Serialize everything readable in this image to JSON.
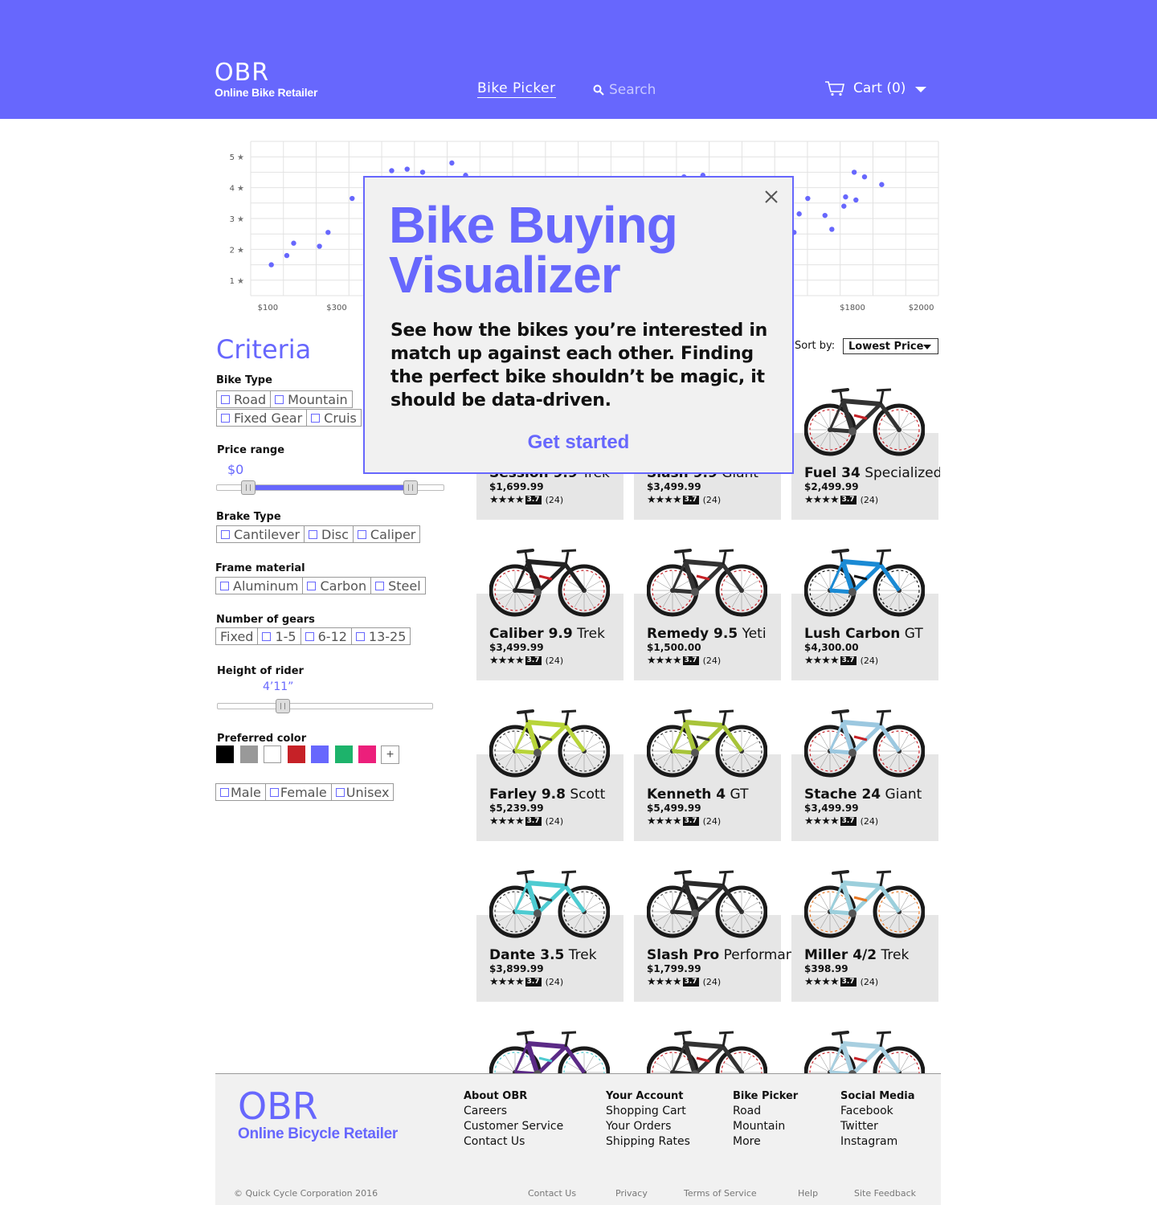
{
  "header": {
    "logo_mark": "OBR",
    "logo_sub": "Online Bike Retailer",
    "nav_link": "Bike Picker",
    "search_placeholder": "Search",
    "cart_label": "Cart (0)",
    "bg_color": "#6767fd"
  },
  "chart_data": {
    "type": "scatter",
    "xlabel": "",
    "ylabel": "",
    "x_ticks": [
      "$100",
      "$300",
      "$1800",
      "$2000"
    ],
    "x_tick_values": [
      100,
      300,
      1800,
      2000
    ],
    "y_ticks": [
      "1",
      "2",
      "3",
      "4",
      "5"
    ],
    "y_tick_values": [
      1,
      2,
      3,
      4,
      5
    ],
    "xlim": [
      50,
      2050
    ],
    "ylim": [
      0.5,
      5.5
    ],
    "grid": true,
    "point_color": "#6767fd",
    "points": [
      [
        110,
        1.5
      ],
      [
        155,
        1.8
      ],
      [
        175,
        2.2
      ],
      [
        250,
        2.1
      ],
      [
        275,
        2.55
      ],
      [
        345,
        3.65
      ],
      [
        390,
        3.3
      ],
      [
        460,
        4.55
      ],
      [
        505,
        4.6
      ],
      [
        550,
        4.5
      ],
      [
        595,
        4.3
      ],
      [
        635,
        4.8
      ],
      [
        675,
        4.4
      ],
      [
        1310,
        4.35
      ],
      [
        1365,
        4.4
      ],
      [
        1520,
        3.2
      ],
      [
        1565,
        3.65
      ],
      [
        1610,
        3.6
      ],
      [
        1630,
        2.55
      ],
      [
        1645,
        3.15
      ],
      [
        1670,
        3.65
      ],
      [
        1720,
        3.1
      ],
      [
        1740,
        2.65
      ],
      [
        1775,
        3.4
      ],
      [
        1780,
        3.7
      ],
      [
        1805,
        4.5
      ],
      [
        1810,
        3.6
      ],
      [
        1835,
        4.35
      ],
      [
        1885,
        4.1
      ]
    ]
  },
  "criteria": {
    "title": "Criteria",
    "bike_type_label": "Bike Type",
    "bike_types_row1": [
      "Road",
      "Mountain"
    ],
    "bike_types_row2": [
      "Fixed Gear",
      "Cruis"
    ],
    "price_label": "Price range",
    "price_min": "$0",
    "price_low": 0.1,
    "price_high": 0.9,
    "brake_label": "Brake Type",
    "brakes": [
      "Cantilever",
      "Disc",
      "Caliper"
    ],
    "frame_label": "Frame material",
    "frames": [
      "Aluminum",
      "Carbon",
      "Steel"
    ],
    "gears_label": "Number of gears",
    "gears": [
      "Fixed",
      "1-5",
      "6-12",
      "13-25"
    ],
    "height_label": "Height of rider",
    "height_value": "4’11”",
    "height_fraction": 0.27,
    "color_label": "Preferred color",
    "colors": [
      "#000000",
      "#999999",
      "#ffffff",
      "#c62127",
      "#6767fd",
      "#1db36b",
      "#ec1f7b"
    ],
    "add_color": "+",
    "genders": [
      "Male",
      "Female",
      "Unisex"
    ]
  },
  "sort": {
    "label": "Sort by:",
    "selected": "Lowest Price"
  },
  "products": [
    {
      "model": "Session 9.9",
      "brand": "Trek",
      "price": "$1,699.99",
      "score": "3.7",
      "count": "(24)",
      "frame": "#222222",
      "accent": "#c62127"
    },
    {
      "model": "Slash 9.9",
      "brand": "Giant",
      "price": "$3,499.99",
      "score": "3.7",
      "count": "(24)",
      "frame": "#333333",
      "accent": "#c62127"
    },
    {
      "model": "Fuel 34",
      "brand": "Specialized",
      "price": "$2,499.99",
      "score": "3.7",
      "count": "(24)",
      "frame": "#333333",
      "accent": "#c62127"
    },
    {
      "model": "Caliber 9.9",
      "brand": "Trek",
      "price": "$3,499.99",
      "score": "3.7",
      "count": "(24)",
      "frame": "#222222",
      "accent": "#c62127"
    },
    {
      "model": "Remedy 9.5",
      "brand": "Yeti",
      "price": "$1,500.00",
      "score": "3.7",
      "count": "(24)",
      "frame": "#333333",
      "accent": "#c62127"
    },
    {
      "model": "Lush Carbon",
      "brand": "GT",
      "price": "$4,300.00",
      "score": "3.7",
      "count": "(24)",
      "frame": "#1a8ad4",
      "accent": "#111111"
    },
    {
      "model": "Farley 9.8",
      "brand": "Scott",
      "price": "$5,239.99",
      "score": "3.7",
      "count": "(24)",
      "frame": "#b8d43a",
      "accent": "#333333"
    },
    {
      "model": "Kenneth 4",
      "brand": "GT",
      "price": "$5,499.99",
      "score": "3.7",
      "count": "(24)",
      "frame": "#a8c43a",
      "accent": "#333333"
    },
    {
      "model": "Stache 24",
      "brand": "Giant",
      "price": "$3,499.99",
      "score": "3.7",
      "count": "(24)",
      "frame": "#9cc8e0",
      "accent": "#c62127"
    },
    {
      "model": "Dante 3.5",
      "brand": "Trek",
      "price": "$3,899.99",
      "score": "3.7",
      "count": "(24)",
      "frame": "#4ecbd1",
      "accent": "#333333"
    },
    {
      "model": "Slash Pro",
      "brand": "Performance",
      "price": "$1,799.99",
      "score": "3.7",
      "count": "(24)",
      "frame": "#2a2a2a",
      "accent": "#555555"
    },
    {
      "model": "Miller 4/2",
      "brand": "Trek",
      "price": "$398.99",
      "score": "3.7",
      "count": "(24)",
      "frame": "#9ccfdc",
      "accent": "#e87722"
    },
    {
      "model": "",
      "brand": "",
      "price": "",
      "score": "",
      "count": "",
      "frame": "#5b2a86",
      "accent": "#4ecbd1"
    },
    {
      "model": "",
      "brand": "",
      "price": "",
      "score": "",
      "count": "",
      "frame": "#333333",
      "accent": "#c62127"
    },
    {
      "model": "",
      "brand": "",
      "price": "",
      "score": "",
      "count": "",
      "frame": "#a8cfe0",
      "accent": "#c62127"
    }
  ],
  "modal": {
    "title": "Bike Buying Visualizer",
    "body": "See how the bikes you’re interested in match up against each other. Finding the perfect bike shouldn’t be magic, it should be data-driven.",
    "cta": "Get started"
  },
  "footer": {
    "logo_mark": "OBR",
    "logo_sub": "Online Bicycle Retailer",
    "col1": {
      "heading": "About OBR",
      "links": [
        "Careers",
        "Customer Service",
        "Contact Us"
      ]
    },
    "col2": {
      "heading": "Your Account",
      "links": [
        "Shopping Cart",
        "Your Orders",
        "Shipping Rates"
      ]
    },
    "col3": {
      "heading": "Bike Picker",
      "links": [
        "Road",
        "Mountain",
        "More"
      ]
    },
    "col4": {
      "heading": "Social Media",
      "links": [
        "Facebook",
        "Twitter",
        "Instagram"
      ]
    },
    "copyright": "© Quick Cycle Corporation 2016",
    "bottom_links": [
      "Contact Us",
      "Privacy",
      "Terms of Service",
      "Help",
      "Site Feedback"
    ]
  }
}
